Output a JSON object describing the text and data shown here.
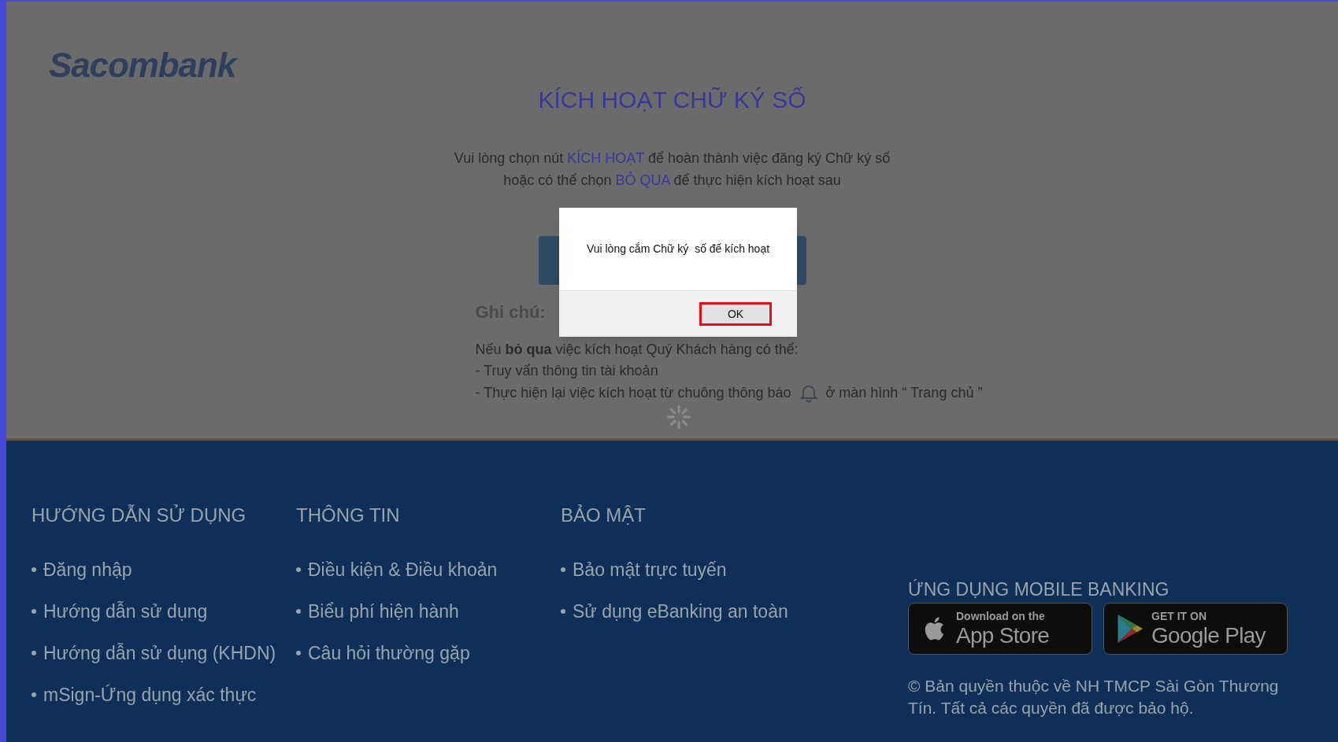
{
  "header": {
    "logo": "Sacombank"
  },
  "activation": {
    "title": "KÍCH HOẠT CHỮ KÝ SỐ",
    "lines": [
      [
        {
          "text": "Vui lòng chọn nút ",
          "highlight": false
        },
        {
          "text": "KÍCH HOẠT",
          "highlight": true
        },
        {
          "text": " để hoàn thành việc đăng ký Chữ ký số",
          "highlight": false
        }
      ],
      [
        {
          "text": "hoặc có thể chọn ",
          "highlight": false
        },
        {
          "text": "BỎ QUA",
          "highlight": true
        },
        {
          "text": " để thực hiện kích hoạt sau",
          "highlight": false
        }
      ]
    ],
    "note_title": "Ghi chú:",
    "note_intro": "Nếu **bỏ qua** việc kích hoạt Quý Khách hàng có thể:",
    "note_items": [
      {
        "text": "- Truy vấn thông tin tài khoản",
        "bell": false
      },
      {
        "text": "- Thực hiện lại việc kích hoạt từ chuông thông báo",
        "bell": true,
        "after": "ở màn hình “ Trang chủ ”"
      }
    ]
  },
  "dialog": {
    "message": "Vui lòng cắm Chữ ký  số để kích hoạt",
    "button": "OK"
  },
  "footer": {
    "columns": [
      {
        "title": "HƯỚNG DẪN SỬ DỤNG",
        "items": [
          "Đăng nhập",
          "Hướng dẫn sử dụng",
          "Hướng dẫn sử dụng (KHDN)",
          "mSign-Ứng dụng xác thực"
        ]
      },
      {
        "title": "THÔNG TIN",
        "items": [
          "Điều kiện & Điều khoản",
          "Biểu phí hiện hành",
          "Câu hỏi thường gặp"
        ]
      },
      {
        "title": "BẢO MẬT",
        "items": [
          "Bảo mật trực tuyến",
          "Sử dụng eBanking an toàn"
        ]
      }
    ],
    "apps": {
      "title": "ỨNG DỤNG MOBILE BANKING",
      "badges": [
        {
          "kind": "apple",
          "small": "Download on the",
          "big": "App Store"
        },
        {
          "kind": "google",
          "small": "GET IT ON",
          "big": "Google Play"
        }
      ]
    },
    "copyright": "© Bản quyền thuộc về NH TMCP Sài Gòn Thương Tín. Tất cả các quyền đã được bảo hộ."
  }
}
